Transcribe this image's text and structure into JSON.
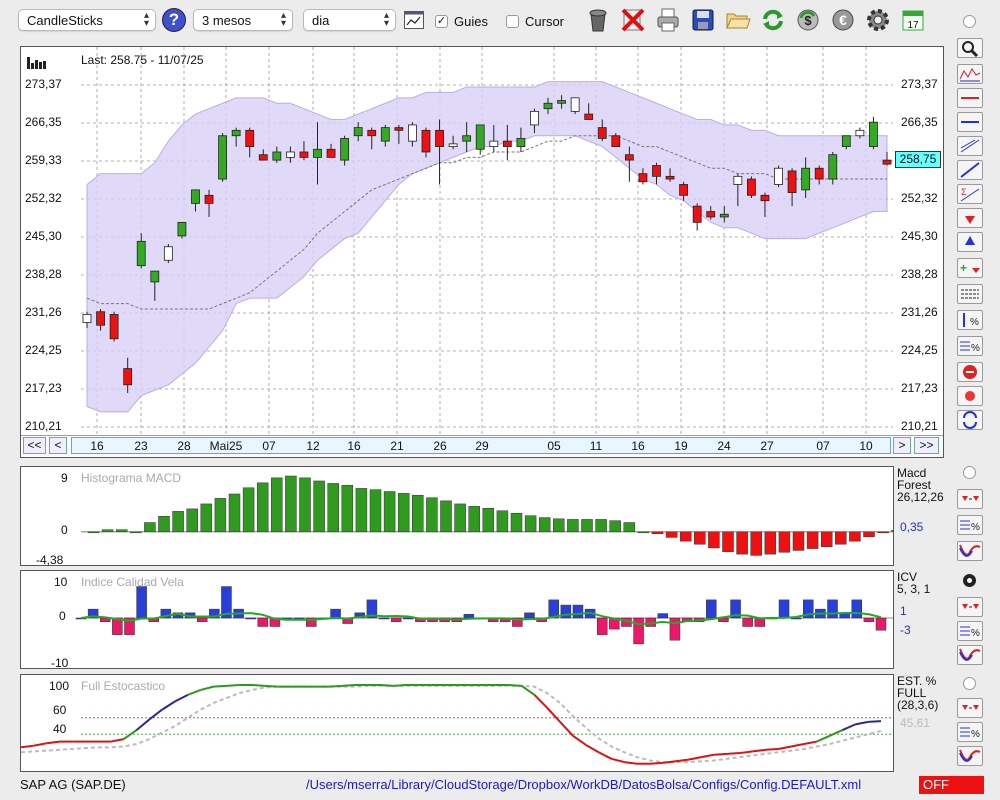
{
  "toolbar": {
    "chart_type": "CandleSticks",
    "period": "3 mesos",
    "interval": "dia",
    "guides_label": "Guies",
    "guides_checked": true,
    "cursor_label": "Cursor",
    "cursor_checked": false,
    "icons": [
      "help-icon",
      "line-chart-icon",
      "trash-icon",
      "delete-icon",
      "print-icon",
      "save-icon",
      "folder-icon",
      "refresh-icon",
      "dollar-icon",
      "euro-icon",
      "settings-icon",
      "calendar-icon"
    ],
    "calendar_day": "17"
  },
  "main": {
    "last_label": "Last: 258.75 - 11/07/25",
    "price_labels": [
      "273,37",
      "266,35",
      "259,33",
      "252,32",
      "245,30",
      "238,28",
      "231,26",
      "224,25",
      "217,23",
      "210,21"
    ],
    "last_price": "258,75",
    "last_price_color": "#66ffff",
    "date_labels": [
      "16",
      "23",
      "28",
      "Mai25",
      "07",
      "12",
      "16",
      "21",
      "26",
      "29",
      "05",
      "11",
      "16",
      "19",
      "24",
      "27",
      "07",
      "10"
    ],
    "nav": {
      "first": "<<",
      "prev": "<",
      "next": ">",
      "last": ">>"
    },
    "colors": {
      "up": "#33aa22",
      "down": "#ee1111",
      "band": "#d8d0f5"
    }
  },
  "macd": {
    "title": "Histograma MACD",
    "y_labels": [
      "9",
      "0",
      "-4,38"
    ],
    "legend": [
      "Macd",
      "Forest",
      "26,12,26"
    ],
    "value": "0,35"
  },
  "icv": {
    "title": "Indice Calidad Vela",
    "y_labels": [
      "10",
      "0",
      "-10"
    ],
    "legend": [
      "ICV",
      "5, 3, 1"
    ],
    "value_pos": "1",
    "value_neg": "-3"
  },
  "stoch": {
    "title": "Full Estocastico",
    "y_labels": [
      "100",
      "60",
      "40"
    ],
    "legend": [
      "EST. %",
      "FULL",
      "(28,3,6)"
    ],
    "value": "45,61"
  },
  "status": {
    "ticker": "SAP AG (SAP.DE)",
    "path": "/Users/mserra/Library/CloudStorage/Dropbox/WorkDB/DatosBolsa/Configs/Config.DEFAULT.xml",
    "state": "OFF"
  },
  "chart_data": [
    {
      "type": "candlestick",
      "title": "",
      "ylim": [
        210.21,
        277
      ],
      "last": 258.75,
      "candles": [
        [
          229.5,
          231.5,
          228.5,
          231.0
        ],
        [
          231.5,
          232.0,
          228.0,
          229.0
        ],
        [
          231.0,
          231.5,
          226.0,
          226.5
        ],
        [
          221.0,
          223.0,
          216.5,
          218.0
        ],
        [
          240.0,
          246.0,
          239.5,
          244.5
        ],
        [
          237.0,
          239.0,
          233.5,
          239.0
        ],
        [
          241.0,
          244.0,
          240.5,
          243.5
        ],
        [
          245.5,
          248.0,
          245.0,
          248.0
        ],
        [
          251.5,
          254.0,
          250.0,
          254.0
        ],
        [
          253.0,
          254.0,
          249.0,
          251.5
        ],
        [
          256.0,
          264.5,
          255.5,
          264.0
        ],
        [
          264.0,
          265.5,
          262.0,
          265.0
        ],
        [
          265.0,
          265.5,
          260.0,
          262.0
        ],
        [
          260.5,
          261.5,
          259.5,
          259.5
        ],
        [
          259.5,
          262.0,
          259.0,
          261.0
        ],
        [
          260.0,
          262.0,
          259.0,
          261.0
        ],
        [
          261.0,
          263.0,
          259.5,
          260.0
        ],
        [
          260.0,
          266.5,
          255.0,
          261.5
        ],
        [
          261.5,
          262.5,
          260.0,
          260.0
        ],
        [
          259.5,
          264.0,
          258.5,
          263.5
        ],
        [
          264.0,
          266.5,
          263.0,
          265.5
        ],
        [
          265.0,
          265.5,
          261.5,
          264.0
        ],
        [
          263.0,
          266.0,
          262.0,
          265.5
        ],
        [
          265.5,
          266.0,
          262.5,
          265.0
        ],
        [
          263.0,
          266.5,
          262.0,
          266.0
        ],
        [
          265.0,
          265.5,
          260.0,
          261.0
        ],
        [
          265.0,
          267.0,
          255.0,
          262.0
        ],
        [
          262.0,
          264.0,
          261.5,
          262.5
        ],
        [
          263.0,
          266.5,
          261.0,
          264.0
        ],
        [
          261.5,
          266.0,
          260.5,
          266.0
        ],
        [
          262.0,
          266.0,
          261.0,
          263.0
        ],
        [
          263.0,
          266.0,
          259.5,
          262.0
        ],
        [
          262.0,
          265.5,
          261.0,
          263.5
        ],
        [
          266.0,
          269.0,
          264.5,
          268.5
        ],
        [
          269.0,
          271.0,
          268.0,
          270.0
        ],
        [
          270.0,
          271.5,
          269.0,
          270.5
        ],
        [
          268.5,
          271.0,
          268.0,
          271.0
        ],
        [
          268.0,
          270.0,
          267.0,
          267.0
        ],
        [
          265.5,
          267.0,
          263.0,
          263.5
        ],
        [
          264.0,
          264.5,
          262.0,
          262.0
        ],
        [
          260.5,
          262.0,
          255.5,
          259.5
        ],
        [
          257.0,
          258.0,
          255.0,
          255.5
        ],
        [
          258.5,
          259.0,
          255.0,
          256.5
        ],
        [
          256.5,
          258.0,
          255.5,
          256.0
        ],
        [
          255.0,
          255.5,
          252.0,
          253.0
        ],
        [
          251.0,
          251.5,
          246.5,
          248.0
        ],
        [
          250.0,
          251.0,
          248.5,
          249.0
        ],
        [
          249.0,
          251.0,
          248.0,
          249.5
        ],
        [
          255.0,
          257.0,
          251.0,
          256.5
        ],
        [
          256.0,
          256.5,
          252.5,
          253.0
        ],
        [
          253.0,
          253.5,
          249.0,
          252.0
        ],
        [
          255.0,
          258.5,
          254.5,
          258.0
        ],
        [
          257.5,
          258.0,
          251.0,
          253.5
        ],
        [
          254.0,
          260.0,
          252.5,
          258.0
        ],
        [
          258.0,
          258.5,
          255.0,
          256.0
        ],
        [
          256.0,
          261.0,
          255.0,
          260.5
        ],
        [
          262.0,
          264.0,
          261.5,
          264.0
        ],
        [
          264.0,
          265.5,
          263.5,
          265.0
        ],
        [
          262.0,
          267.5,
          261.5,
          266.5
        ],
        [
          259.5,
          261.0,
          258.5,
          258.75
        ]
      ],
      "upper_band": [
        255,
        257,
        257,
        257,
        257,
        259,
        263,
        266,
        268,
        269,
        270,
        271,
        271,
        271,
        270,
        270,
        269,
        268,
        267,
        267,
        268,
        269,
        270,
        271,
        271,
        272,
        272,
        272,
        273,
        273,
        273,
        273,
        273,
        273,
        274,
        274,
        274,
        274,
        274,
        273,
        272,
        271,
        270,
        269,
        268,
        267,
        267,
        266,
        266,
        265,
        265,
        264,
        264,
        264,
        264,
        264,
        264,
        264,
        264,
        264
      ],
      "lower_band": [
        214,
        213,
        213,
        213,
        216,
        217,
        218,
        220,
        222,
        225,
        228,
        233,
        234,
        234,
        234,
        236,
        238,
        241,
        243,
        245,
        246,
        249,
        252,
        255,
        257,
        258,
        259,
        260,
        261,
        262,
        262,
        263,
        263,
        264,
        264,
        264,
        264,
        263,
        262,
        260,
        258,
        256,
        255,
        253,
        252,
        250,
        248,
        247,
        247,
        246,
        245,
        245,
        245,
        245,
        246,
        247,
        248,
        249,
        250,
        250
      ],
      "ma": [
        234,
        233,
        233,
        233,
        232,
        232,
        232,
        232,
        232,
        232,
        233,
        234,
        235,
        237,
        239,
        241,
        243,
        246,
        248,
        250,
        252,
        254,
        255,
        256,
        257,
        258,
        259,
        259,
        260,
        260,
        261,
        261,
        261,
        262,
        263,
        263,
        264,
        264,
        264,
        264,
        263,
        262,
        262,
        261,
        260,
        259,
        258,
        258,
        257,
        257,
        257,
        256,
        256,
        256,
        256,
        256,
        256,
        256,
        256,
        256
      ]
    },
    {
      "type": "bar",
      "title": "Histograma MACD",
      "ylim": [
        -4.38,
        9
      ],
      "values": [
        0,
        0.35,
        0.35,
        0,
        1.5,
        2.5,
        3.3,
        3.7,
        4.5,
        5.4,
        6.1,
        7.1,
        7.9,
        8.7,
        9.0,
        8.7,
        8.2,
        7.8,
        7.5,
        7.0,
        6.8,
        6.5,
        6.2,
        5.9,
        5.5,
        5.0,
        4.5,
        4.1,
        3.8,
        3.4,
        3.0,
        2.6,
        2.3,
        2.1,
        2.0,
        2.0,
        2.0,
        1.8,
        1.5,
        0,
        -0.3,
        -0.9,
        -1.5,
        -2.0,
        -2.6,
        -3.2,
        -3.6,
        -3.8,
        -3.6,
        -3.3,
        -3.0,
        -2.7,
        -2.4,
        -2.0,
        -1.5,
        -0.8,
        -0.1,
        0.25,
        0.35,
        0.35
      ]
    },
    {
      "type": "bar",
      "title": "Indice Calidad Vela",
      "ylim": [
        -10,
        10
      ],
      "values": [
        0,
        2.4,
        -1,
        -4.5,
        -4.5,
        8.5,
        -1,
        2.4,
        1.4,
        1.4,
        -1,
        2.4,
        8.5,
        2.4,
        0,
        -2.3,
        -2.3,
        0,
        0,
        -2.3,
        0,
        2.4,
        -1.5,
        1.4,
        4.9,
        0,
        -1,
        0,
        -1,
        -1,
        -1,
        -1,
        1,
        0,
        -1,
        -1,
        -2.3,
        1.4,
        -1,
        4.9,
        3.5,
        3.5,
        2.4,
        -4.5,
        -3,
        -2.3,
        -7,
        -2.3,
        1.2,
        -6,
        -1,
        -1,
        4.9,
        -1,
        4.9,
        -2.3,
        -2.3,
        0,
        4.9,
        0,
        4.9,
        2.4,
        4.9,
        1.4,
        4.9,
        -1,
        -3.3
      ],
      "signal_color_up": "#22aa22",
      "signal_color_down": "#ee2222"
    },
    {
      "type": "line",
      "title": "Full Estocastico",
      "ylim": [
        0,
        100
      ],
      "k": [
        24,
        26,
        29,
        31,
        31,
        31,
        31,
        31,
        34,
        45,
        58,
        70,
        80,
        88,
        94,
        98,
        99,
        100,
        100,
        99,
        98,
        98,
        98,
        98,
        98,
        99,
        100,
        100,
        100,
        99,
        100,
        100,
        100,
        100,
        100,
        100,
        100,
        100,
        100,
        99,
        88,
        72,
        55,
        38,
        27,
        18,
        10,
        6,
        4,
        4,
        5,
        7,
        9,
        12,
        15,
        16,
        17,
        19,
        21,
        22,
        25,
        28,
        31,
        38,
        45,
        52,
        55,
        56
      ],
      "d": [
        18,
        19,
        20,
        21,
        22,
        23,
        24,
        24,
        25,
        28,
        34,
        42,
        50,
        60,
        70,
        78,
        84,
        90,
        94,
        97,
        98,
        98,
        98,
        98,
        98,
        98,
        98,
        99,
        99,
        99,
        99,
        99,
        99,
        99,
        99,
        99,
        99,
        99,
        99,
        99,
        98,
        90,
        78,
        62,
        48,
        35,
        25,
        18,
        12,
        8,
        6,
        6,
        6,
        7,
        8,
        10,
        12,
        14,
        16,
        18,
        20,
        22,
        25,
        28,
        32,
        36,
        40,
        44
      ]
    }
  ]
}
